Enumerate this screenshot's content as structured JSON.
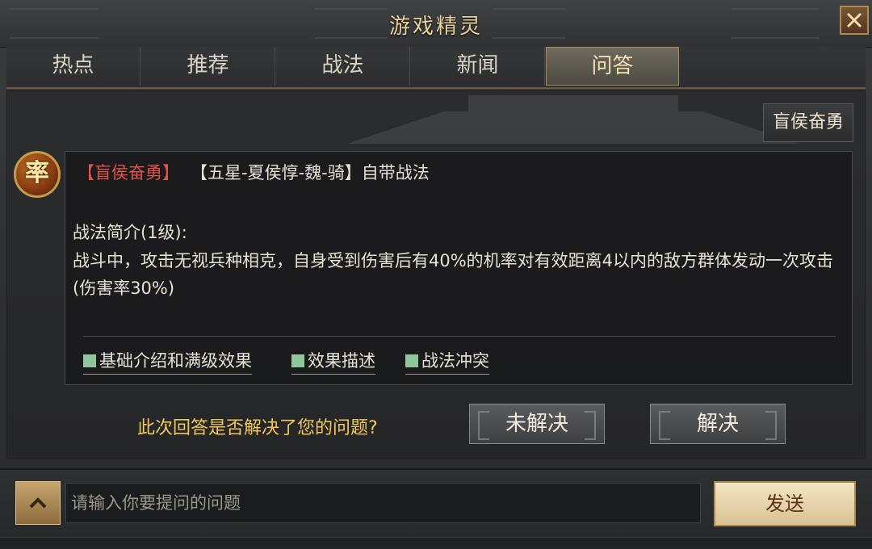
{
  "window": {
    "title": "游戏精灵",
    "close_icon": "close-icon"
  },
  "tabs": [
    {
      "label": "热点",
      "active": false
    },
    {
      "label": "推荐",
      "active": false
    },
    {
      "label": "战法",
      "active": false
    },
    {
      "label": "新闻",
      "active": false
    },
    {
      "label": "问答",
      "active": true
    }
  ],
  "skill_tag": "盲侯奋勇",
  "avatar": {
    "glyph": "率",
    "icon": "general-avatar-icon"
  },
  "answer": {
    "skill_name": "【盲侯奋勇】",
    "hero_info": "【五星-夏侯惇-魏-骑】自带战法",
    "intro_heading": "战法简介(1级):",
    "intro_body": "战斗中，攻击无视兵种相克，自身受到伤害后有40%的机率对有效距离4以内的敌方群体发动一次攻击(伤害率30%)",
    "links": [
      "基础介绍和满级效果",
      "效果描述",
      "战法冲突"
    ]
  },
  "feedback": {
    "question": "此次回答是否解决了您的问题?",
    "unsolved_label": "未解决",
    "solved_label": "解决"
  },
  "input": {
    "placeholder": "请输入你要提问的问题",
    "value": ""
  },
  "send_label": "发送",
  "colors": {
    "accent_gold": "#e9d29a",
    "question_yellow": "#f0c85a",
    "skill_red": "#e35148",
    "link_square": "#8fc79a"
  }
}
